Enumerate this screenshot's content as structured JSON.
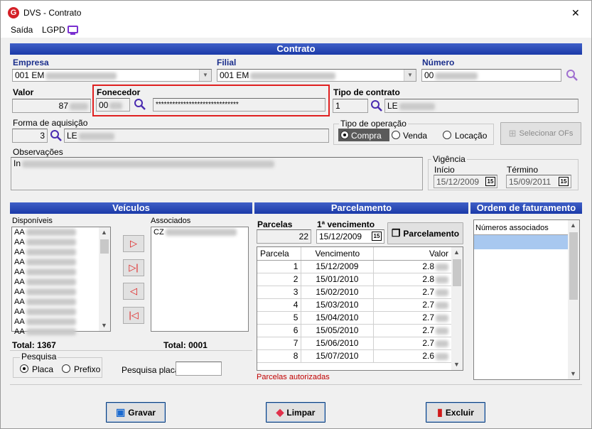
{
  "window": {
    "title": "DVS - Contrato",
    "close": "✕"
  },
  "menu": {
    "saida": "Saída",
    "lgpd": "LGPD"
  },
  "contrato": {
    "header": "Contrato",
    "empresa_label": "Empresa",
    "empresa_value": "001 EM",
    "filial_label": "Filial",
    "filial_value": "001 EM",
    "numero_label": "Número",
    "numero_value": "00",
    "valor_label": "Valor",
    "valor_value": "87",
    "fornecedor_label": "Fonecedor",
    "fornecedor_code": "00",
    "fornecedor_name": "******************************",
    "tipo_contrato_label": "Tipo de contrato",
    "tipo_contrato_code": "1",
    "tipo_contrato_name": "LE",
    "forma_aquisicao_label": "Forma de aquisição",
    "forma_aquisicao_code": "3",
    "forma_aquisicao_name": "LE",
    "tipo_operacao_label": "Tipo de operação",
    "op_compra": "Compra",
    "op_venda": "Venda",
    "op_locacao": "Locação",
    "selecionar_ofs": "Selecionar OFs",
    "observacoes_label": "Observações",
    "observacoes_value": "In",
    "vigencia_label": "Vigência",
    "inicio_label": "Início",
    "inicio_value": "15/12/2009",
    "termino_label": "Término",
    "termino_value": "15/09/2011",
    "cal_icon": "15"
  },
  "veiculos": {
    "header": "Veículos",
    "disponiveis_label": "Disponíveis",
    "associados_label": "Associados",
    "disponiveis": [
      "AA",
      "AA",
      "AA",
      "AA",
      "AA",
      "AA",
      "AA",
      "AA",
      "AA",
      "AA",
      "AA"
    ],
    "associados": [
      "CZ"
    ],
    "total_disp": "Total: 1367",
    "total_assoc": "Total: 0001",
    "pesquisa_label": "Pesquisa",
    "placa": "Placa",
    "prefixo": "Prefixo",
    "pesquisa_placa_label": "Pesquisa placa"
  },
  "parcelamento": {
    "header": "Parcelamento",
    "parcelas_label": "Parcelas",
    "parcelas_value": "22",
    "venc_label": "1ª vencimento",
    "venc_value": "15/12/2009",
    "btn": "Parcelamento",
    "cols": [
      "Parcela",
      "Vencimento",
      "Valor"
    ],
    "rows": [
      [
        "1",
        "15/12/2009",
        "2.8"
      ],
      [
        "2",
        "15/01/2010",
        "2.8"
      ],
      [
        "3",
        "15/02/2010",
        "2.7"
      ],
      [
        "4",
        "15/03/2010",
        "2.7"
      ],
      [
        "5",
        "15/04/2010",
        "2.7"
      ],
      [
        "6",
        "15/05/2010",
        "2.7"
      ],
      [
        "7",
        "15/06/2010",
        "2.7"
      ],
      [
        "8",
        "15/07/2010",
        "2.6"
      ]
    ],
    "autorizadas": "Parcelas autorizadas"
  },
  "ordem": {
    "header": "Ordem de faturamento",
    "col": "Números associados"
  },
  "actions": {
    "gravar": "Gravar",
    "limpar": "Limpar",
    "excluir": "Excluir"
  },
  "colors": {
    "header_blue": "#1b3aa8",
    "highlight_red": "#e02020",
    "accent_purple": "#7a2fd0"
  }
}
